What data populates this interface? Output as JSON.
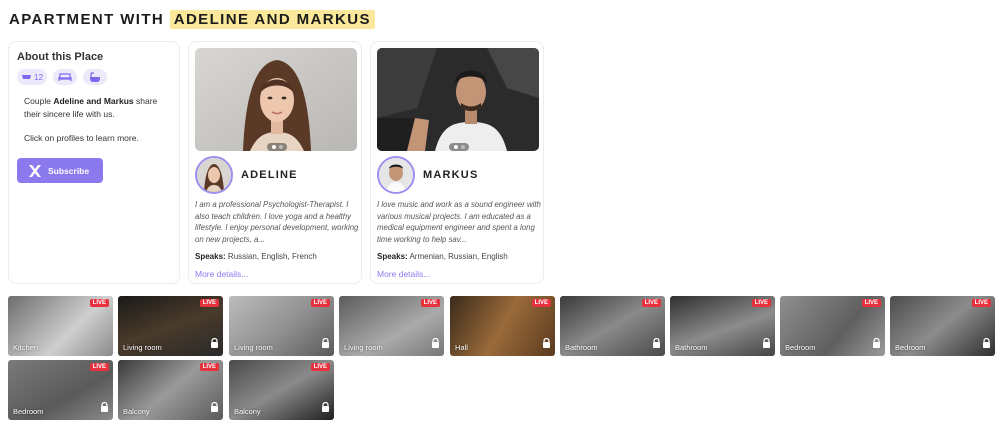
{
  "heading": {
    "prefix": "APARTMENT WITH",
    "highlight": "ADELINE AND MARKUS"
  },
  "about": {
    "title": "About this Place",
    "amenities": [
      {
        "icon": "bed-icon",
        "count": "12"
      },
      {
        "icon": "sofa-icon",
        "count": ""
      },
      {
        "icon": "bathtub-icon",
        "count": ""
      }
    ],
    "desc_pre": "Couple ",
    "desc_names": "Adeline and Markus",
    "desc_post": " share their sincere life with us.",
    "hint": "Click on profiles to learn more.",
    "subscribe": "Subscribe"
  },
  "profiles": [
    {
      "name": "ADELINE",
      "bio": "I am a professional Psychologist-Therapist. I also teach children. I love yoga and a healthy lifestyle. I enjoy personal development, working on new projects, a...",
      "speaks_label": "Speaks:",
      "speaks": "Russian, English, French",
      "more": "More details..."
    },
    {
      "name": "MARKUS",
      "bio": "I love music and work as a sound engineer with various musical projects. I am educated as a medical equipment engineer and spent a long time working to help sav...",
      "speaks_label": "Speaks:",
      "speaks": "Armenian, Russian, English",
      "more": "More details..."
    }
  ],
  "live_badge": "LIVE",
  "cameras": [
    {
      "label": "Kitchen",
      "locked": false
    },
    {
      "label": "Living room",
      "locked": true
    },
    {
      "label": "Living room",
      "locked": true
    },
    {
      "label": "Living room",
      "locked": true
    },
    {
      "label": "Hall",
      "locked": true
    },
    {
      "label": "Bathroom",
      "locked": true
    },
    {
      "label": "Bathroom",
      "locked": true
    },
    {
      "label": "Bedroom",
      "locked": true
    },
    {
      "label": "Bedroom",
      "locked": true
    },
    {
      "label": "Bedroom",
      "locked": true
    },
    {
      "label": "Balcony",
      "locked": true
    },
    {
      "label": "Balcony",
      "locked": true
    }
  ],
  "colors": {
    "accent": "#8a7aee",
    "highlight": "#fbe89a",
    "live": "#e5323e"
  }
}
